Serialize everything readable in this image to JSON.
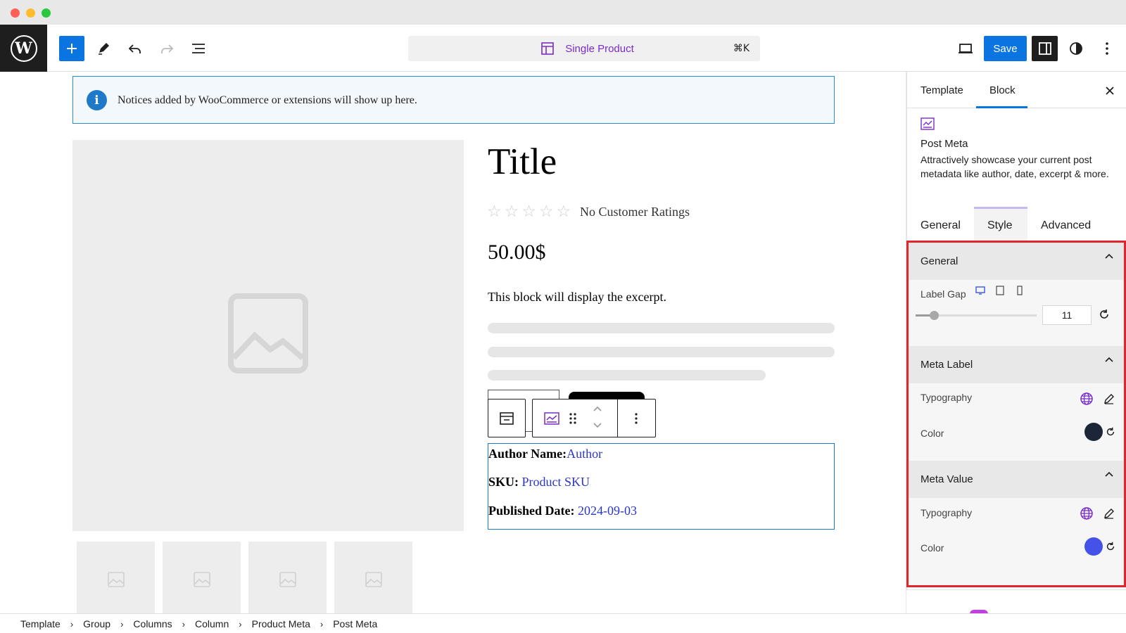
{
  "toolbar": {
    "document_title": "Single Product",
    "shortcut": "⌘K",
    "save_label": "Save",
    "accent_color": "#0a74e0"
  },
  "notice": {
    "text": "Notices added by WooCommerce or extensions will show up here."
  },
  "product": {
    "title": "Title",
    "ratings_text": "No Customer Ratings",
    "price": "50.00$",
    "excerpt": "This block will display the excerpt."
  },
  "post_meta": {
    "rows": [
      {
        "label": "Author Name:",
        "value": "Author"
      },
      {
        "label": "SKU:",
        "value": "Product SKU"
      },
      {
        "label": "Published Date:",
        "value": "2024-09-03"
      }
    ],
    "value_color": "#2a36c9"
  },
  "sidebar": {
    "tabs": [
      "Template",
      "Block"
    ],
    "active_tab": "Block",
    "block_name": "Post Meta",
    "block_description": "Attractively showcase your current post metadata like author, date, excerpt & more.",
    "sub_tabs": [
      "General",
      "Style",
      "Advanced"
    ],
    "active_sub_tab": "Style",
    "sections": {
      "general": {
        "title": "General",
        "label_gap_label": "Label Gap",
        "label_gap_value": "11"
      },
      "meta_label": {
        "title": "Meta Label",
        "typography_label": "Typography",
        "color_label": "Color",
        "color_value": "#1c2638"
      },
      "meta_value": {
        "title": "Meta Value",
        "typography_label": "Typography",
        "color_label": "Color",
        "color_value": "#4452e8"
      }
    }
  },
  "breadcrumb": [
    "Template",
    "Group",
    "Columns",
    "Column",
    "Product Meta",
    "Post Meta"
  ]
}
